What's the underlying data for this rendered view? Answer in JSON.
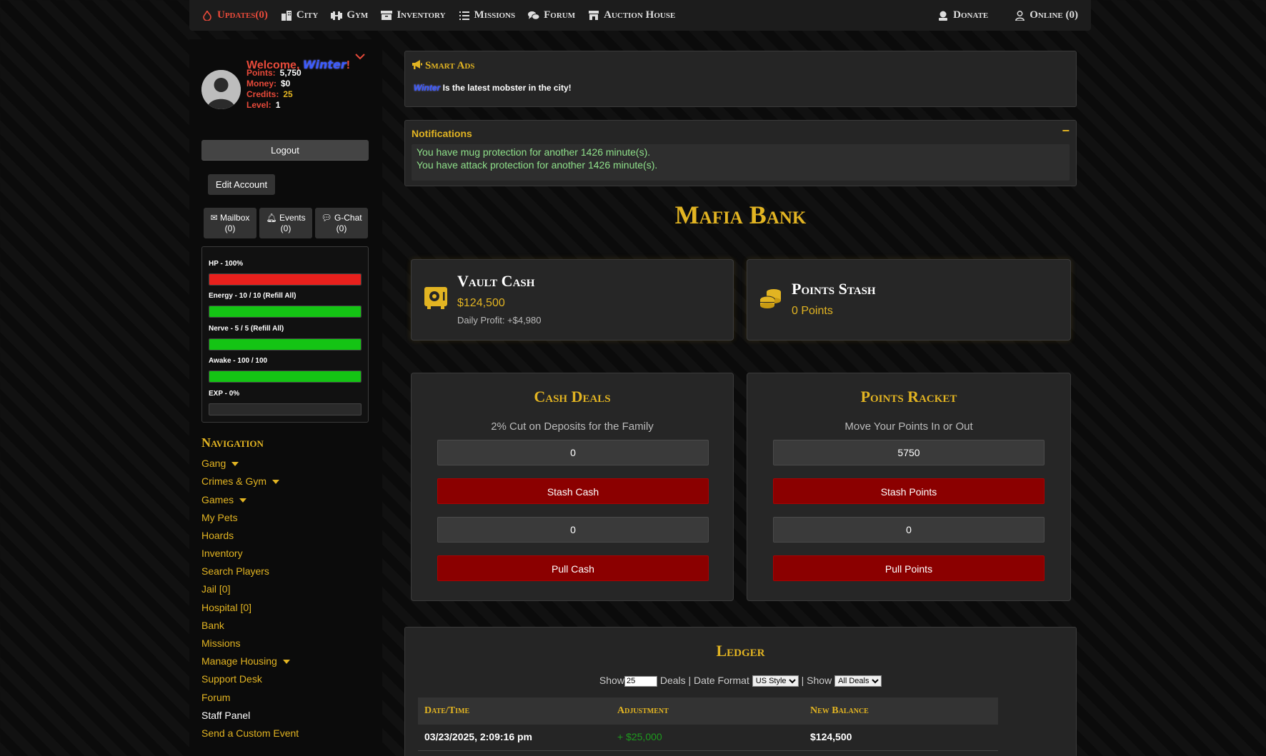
{
  "topnav": {
    "items": [
      {
        "label": "Updates(0)",
        "icon": "flame-icon"
      },
      {
        "label": "City",
        "icon": "city-icon"
      },
      {
        "label": "Gym",
        "icon": "dumbbell-icon"
      },
      {
        "label": "Inventory",
        "icon": "box-icon"
      },
      {
        "label": "Missions",
        "icon": "list-icon"
      },
      {
        "label": "Forum",
        "icon": "comments-icon"
      },
      {
        "label": "Auction House",
        "icon": "store-icon"
      }
    ],
    "right": [
      {
        "label": "Donate",
        "icon": "donate-icon"
      },
      {
        "label": "Online (0)",
        "icon": "user-icon"
      }
    ]
  },
  "profile": {
    "welcome_prefix": "Welcome, ",
    "username": "Winter",
    "welcome_suffix": "!",
    "stats": [
      {
        "key": "Points:",
        "value": "5,750"
      },
      {
        "key": "Money:",
        "value": "$0"
      },
      {
        "key": "Credits:",
        "value": "25"
      },
      {
        "key": "Level:",
        "value": "1"
      }
    ]
  },
  "account": {
    "logout": "Logout",
    "edit": "Edit Account",
    "mailbox": "Mailbox",
    "mailbox_count": "(0)",
    "events": "Events",
    "events_count": "(0)",
    "gchat": "G-Chat",
    "gchat_count": "(0)"
  },
  "bars": [
    {
      "label": "HP - 100%",
      "fill": 1.0,
      "color": "#e8201c"
    },
    {
      "label": "Energy - 10 / 10 (Refill All)",
      "fill": 1.0,
      "color": "#14c414"
    },
    {
      "label": "Nerve - 5 / 5 (Refill All)",
      "fill": 1.0,
      "color": "#14c414"
    },
    {
      "label": "Awake - 100 / 100",
      "fill": 1.0,
      "color": "#14c414"
    },
    {
      "label": "EXP - 0%",
      "fill": 0.0,
      "color": "#14c414"
    }
  ],
  "navigation": {
    "title": "Navigation",
    "links": [
      {
        "label": "Gang",
        "caret": true
      },
      {
        "label": "Crimes & Gym",
        "caret": true
      },
      {
        "label": "Games",
        "caret": true
      },
      {
        "label": "My Pets"
      },
      {
        "label": "Hoards"
      },
      {
        "label": "Inventory"
      },
      {
        "label": "Search Players"
      },
      {
        "label": "Jail [0]"
      },
      {
        "label": "Hospital [0]"
      },
      {
        "label": "Bank"
      },
      {
        "label": "Missions"
      },
      {
        "label": "Manage Housing",
        "caret": true
      },
      {
        "label": "Support Desk"
      },
      {
        "label": "Forum"
      },
      {
        "label": "Staff Panel"
      },
      {
        "label": "Send a Custom Event"
      }
    ]
  },
  "smart_ads": {
    "title": "Smart Ads",
    "username": "Winter",
    "message": " Is the latest mobster in the city!"
  },
  "notifications": {
    "title": "Notifications",
    "collapse": "−",
    "lines": [
      "You have mug protection for another 1426 minute(s).",
      "You have attack protection for another 1426 minute(s)."
    ]
  },
  "bank": {
    "title": "Mafia Bank",
    "vault": {
      "title": "Vault Cash",
      "value": "$124,500",
      "sub": "Daily Profit: +$4,980"
    },
    "stash": {
      "title": "Points Stash",
      "value": "0 Points"
    },
    "cash_deals": {
      "title": "Cash Deals",
      "subtitle": "2% Cut on Deposits for the Family",
      "deposit_value": "0",
      "deposit_button": "Stash Cash",
      "withdraw_value": "0",
      "withdraw_button": "Pull Cash"
    },
    "points_racket": {
      "title": "Points Racket",
      "subtitle": "Move Your Points In or Out",
      "deposit_value": "5750",
      "deposit_button": "Stash Points",
      "withdraw_value": "0",
      "withdraw_button": "Pull Points"
    }
  },
  "ledger": {
    "title": "Ledger",
    "show_label": "Show",
    "show_value": "25",
    "deals_label": " Deals | Date Format ",
    "date_format": "US Style",
    "show2_label": " | Show ",
    "filter": "All Deals",
    "columns": [
      "Date/Time",
      "Adjustment",
      "New Balance"
    ],
    "rows": [
      {
        "datetime": "03/23/2025, 2:09:16 pm",
        "adjustment": "+ $25,000",
        "balance": "$124,500"
      }
    ]
  }
}
